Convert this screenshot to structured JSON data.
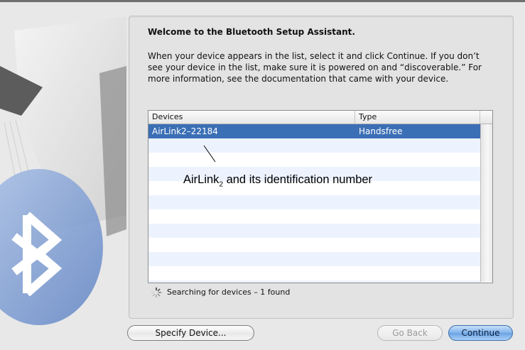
{
  "window": {
    "heading": "Welcome to the Bluetooth Setup Assistant.",
    "instructions": "When your device appears in the list, select it and click Continue. If you don’t see your device in the list, make sure it is powered on and “discoverable.” For more information, see the documentation that came with your device."
  },
  "devices_table": {
    "columns": [
      "Devices",
      "Type"
    ],
    "rows": [
      {
        "device": "AirLink2–22184",
        "type": "Handsfree",
        "selected": true
      }
    ]
  },
  "annotation": {
    "text_prefix": "AirLink",
    "subscript": "2",
    "text_suffix": " and its identification number"
  },
  "status": {
    "icon": "spinner-icon",
    "text": "Searching for devices – 1 found"
  },
  "buttons": {
    "specify": "Specify Device...",
    "back": "Go Back",
    "continue": "Continue"
  },
  "colors": {
    "selection": "#3b6fb5",
    "alt_row": "#edf3fe",
    "default_button": "#7fb1ea"
  }
}
